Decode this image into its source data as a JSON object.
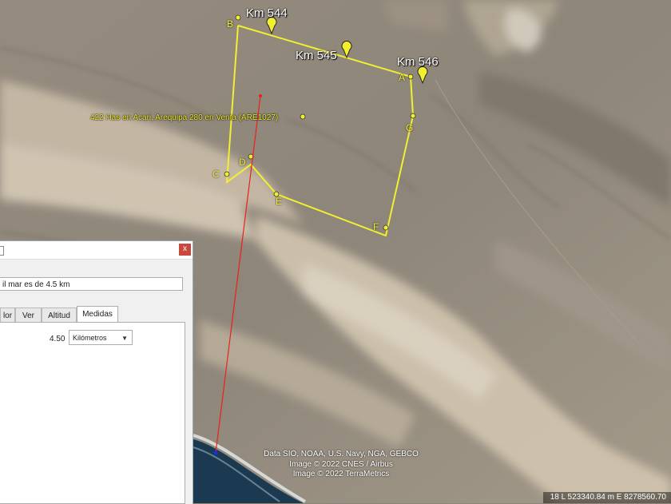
{
  "map": {
    "km_markers": [
      {
        "label": "Km 544"
      },
      {
        "label": "Km 545"
      },
      {
        "label": "Km 546"
      }
    ],
    "points": [
      "A",
      "B",
      "C",
      "D",
      "E",
      "F",
      "G"
    ],
    "poi_label": "422 Has en Acari, Arequipa 280 en Venta (ARE1027)",
    "attribution": [
      "Data SIO, NOAA, U.S. Navy, NGA, GEBCO",
      "Image © 2022 CNES / Airbus",
      "Image © 2022 TerraMetrics"
    ],
    "coordinates": "18 L 523340.84 m E 8278560.70",
    "colors": {
      "polygon": "#f2ee30",
      "ruler": "#e8221a",
      "ruler_end": "#1430e6",
      "ocean": "#1b3a52"
    }
  },
  "dialog": {
    "close_label": "x",
    "name_value": "il mar es de 4.5 km",
    "tabs": [
      "lor",
      "Ver",
      "Altitud",
      "Medidas"
    ],
    "active_tab": "Medidas",
    "measure_value": "4.50",
    "unit_value": "Kilómetros",
    "dropdown_icon": "▼"
  }
}
